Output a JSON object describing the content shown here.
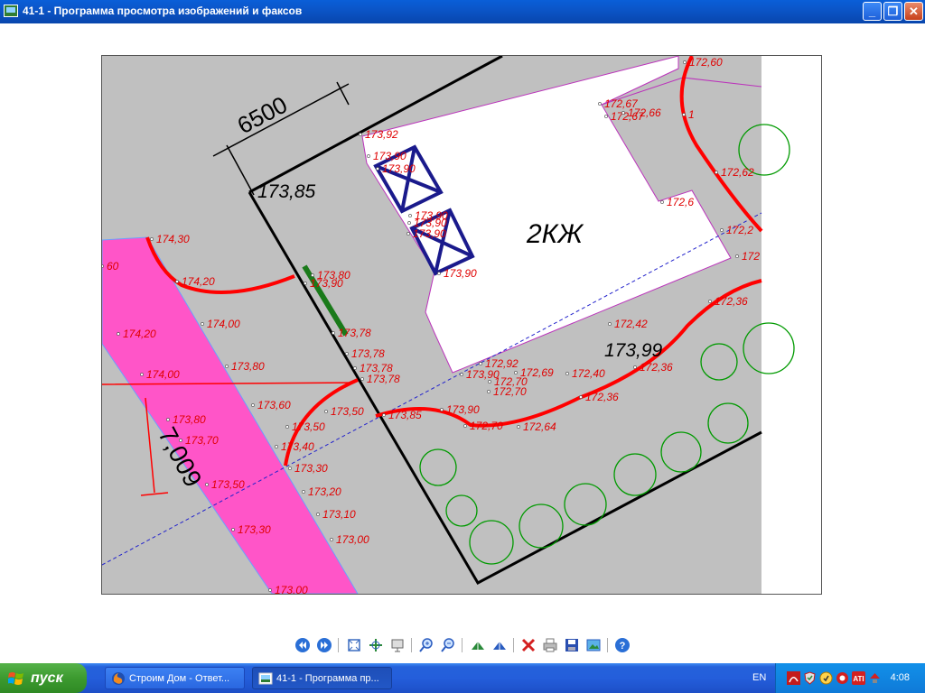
{
  "window": {
    "title": "41-1 - Программа просмотра изображений и факсов",
    "controls": {
      "minimize": "_",
      "maximize": "❐",
      "close": "✕"
    }
  },
  "drawing": {
    "dimension_top": "6500",
    "dimension_left": "7,009",
    "building_label": "2КЖ",
    "elevation_big_1": "173,85",
    "elevation_big_2": "173,99",
    "levels": [
      "173,92",
      "173,90",
      "173,90",
      "172,67",
      "172,67",
      "172,66",
      "1",
      "172,62",
      "172,6",
      "172,2",
      "172,60",
      "174,30",
      "174,20",
      "173,80",
      "173,90",
      "173,90",
      "173,90",
      "173,90",
      "173,90",
      "174,20",
      "174,00",
      "173,78",
      "173,78",
      "173,78",
      "172,42",
      "172,36",
      "174,00",
      "173,80",
      "173,78",
      "172,92",
      "172,69",
      "172,40",
      "172,36",
      "173,90",
      "172,70",
      "172,70",
      "173,60",
      "173,50",
      "173,50",
      "172,36",
      "173,85",
      "173,90",
      "172,70",
      "172,64",
      "173,80",
      "173,70",
      "173,40",
      "173,30",
      "173,50",
      "173,20",
      "173,10",
      "173,00",
      "173,30",
      "173,00",
      "60",
      "172"
    ]
  },
  "toolbar": {
    "buttons": [
      {
        "name": "previous-image",
        "icon": "prev-icon"
      },
      {
        "name": "next-image",
        "icon": "next-icon"
      },
      {
        "name": "best-fit",
        "icon": "best-fit-icon"
      },
      {
        "name": "actual-size",
        "icon": "actual-size-icon"
      },
      {
        "name": "slideshow",
        "icon": "slideshow-icon"
      },
      {
        "name": "zoom-in",
        "icon": "zoom-in-icon"
      },
      {
        "name": "zoom-out",
        "icon": "zoom-out-icon"
      },
      {
        "name": "rotate-clockwise",
        "icon": "rotate-cw-icon"
      },
      {
        "name": "rotate-counterclockwise",
        "icon": "rotate-ccw-icon"
      },
      {
        "name": "delete",
        "icon": "delete-icon"
      },
      {
        "name": "print",
        "icon": "print-icon"
      },
      {
        "name": "save-copy",
        "icon": "save-icon"
      },
      {
        "name": "open-editor",
        "icon": "edit-icon"
      },
      {
        "name": "help",
        "icon": "help-icon"
      }
    ]
  },
  "taskbar": {
    "start_label": "пуск",
    "tasks": [
      {
        "label": "Строим Дом - Ответ...",
        "icon": "firefox-icon",
        "active": false
      },
      {
        "label": "41-1 - Программа пр...",
        "icon": "image-viewer-icon",
        "active": true
      }
    ],
    "language": "EN",
    "clock": "4:08"
  },
  "colors": {
    "titlebar": "#0b55c8",
    "drawing_gray": "#c0c0c0",
    "pink_strip": "#ff55c8",
    "red_line": "#ff0000",
    "blue_frames": "#1a1a8c",
    "green_plants": "#009a00",
    "taskbar": "#245edb",
    "start_green": "#3c9a2f"
  }
}
